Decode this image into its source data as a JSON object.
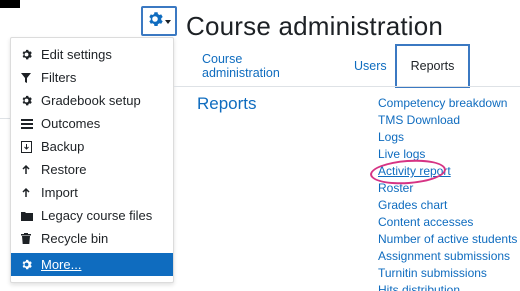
{
  "page": {
    "title": "Course administration"
  },
  "gear_menu": {
    "icon": "gear-icon",
    "items": [
      {
        "label": "Edit settings",
        "icon": "gear-icon"
      },
      {
        "label": "Filters",
        "icon": "filter-icon"
      },
      {
        "label": "Gradebook setup",
        "icon": "gear-icon"
      },
      {
        "label": "Outcomes",
        "icon": "outcomes-icon"
      },
      {
        "label": "Backup",
        "icon": "backup-icon"
      },
      {
        "label": "Restore",
        "icon": "restore-icon"
      },
      {
        "label": "Import",
        "icon": "import-icon"
      },
      {
        "label": "Legacy course files",
        "icon": "folder-icon"
      },
      {
        "label": "Recycle bin",
        "icon": "trash-icon"
      },
      {
        "label": "More...",
        "icon": "gear-icon",
        "active": true
      }
    ]
  },
  "tabs": [
    {
      "label": "Course administration"
    },
    {
      "label": "Users"
    },
    {
      "label": "Reports",
      "selected": true
    }
  ],
  "section": {
    "title": "Reports"
  },
  "reports": [
    "Competency breakdown",
    "TMS Download",
    "Logs",
    "Live logs",
    "Activity report",
    "Roster",
    "Grades chart",
    "Content accesses",
    "Number of active students",
    "Assignment submissions",
    "Turnitin submissions",
    "Hits distribution"
  ],
  "colors": {
    "link": "#0f6cbf",
    "active_bg": "#0f6cbf",
    "highlight_border": "#3b79c2",
    "annotation": "#d63384"
  }
}
